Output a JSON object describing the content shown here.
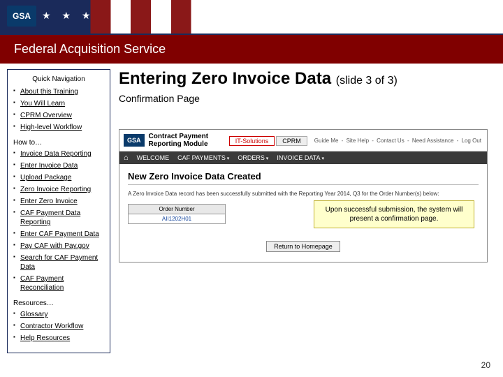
{
  "header": {
    "logo": "GSA",
    "service_title": "Federal Acquisition Service"
  },
  "sidebar": {
    "heading": "Quick Navigation",
    "group1": [
      "About this Training",
      "You Will Learn",
      "CPRM Overview",
      "High-level Workflow"
    ],
    "howto_label": "How to…",
    "howto": [
      "Invoice Data Reporting",
      "Enter Invoice Data",
      "Upload Package",
      "Zero Invoice Reporting",
      "Enter Zero Invoice",
      "CAF Payment Data Reporting",
      "Enter CAF Payment Data",
      "Pay CAF with Pay.gov",
      "Search for CAF Payment Data",
      "CAF Payment Reconciliation"
    ],
    "resources_label": "Resources…",
    "resources": [
      "Glossary",
      "Contractor Workflow",
      "Help Resources"
    ]
  },
  "main": {
    "title": "Entering Zero Invoice Data",
    "slide_marker": "(slide 3 of 3)",
    "subtitle": "Confirmation Page"
  },
  "screenshot": {
    "logo": "GSA",
    "module_title_l1": "Contract Payment",
    "module_title_l2": "Reporting Module",
    "tab_it": "IT-Solutions",
    "tab_cprm": "CPRM",
    "toplinks": [
      "Guide Me",
      "Site Help",
      "Contact Us",
      "Need Assistance",
      "Log Out"
    ],
    "nav": {
      "home": "⌂",
      "welcome": "WELCOME",
      "caf": "CAF PAYMENTS",
      "orders": "ORDERS",
      "invoice": "INVOICE DATA"
    },
    "page_heading": "New Zero Invoice Data Created",
    "confirm_text": "A Zero Invoice Data record has been successfully submitted with the Reporting Year 2014, Q3 for the Order Number(s) below:",
    "table_header": "Order Number",
    "table_value": "AII1202H01",
    "return_btn": "Return to Homepage"
  },
  "callout": "Upon successful submission, the system will present a confirmation page.",
  "page_number": "20"
}
